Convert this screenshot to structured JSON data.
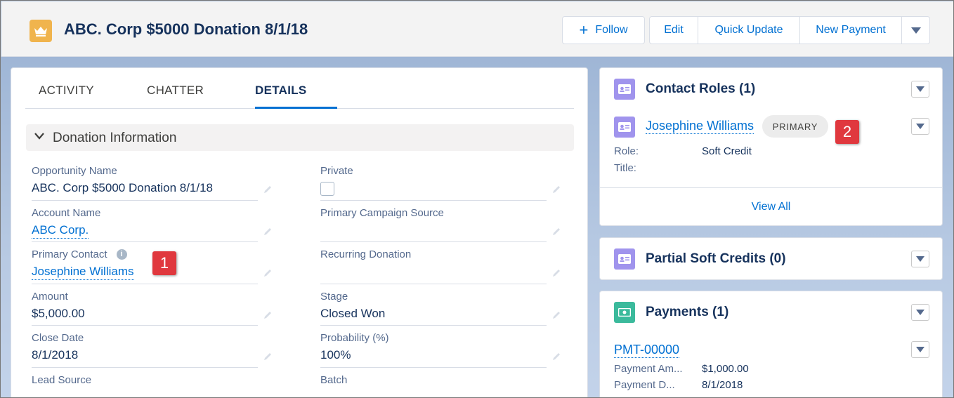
{
  "header": {
    "icon": "crown-icon",
    "title": "ABC. Corp $5000 Donation 8/1/18",
    "follow_label": "Follow",
    "actions": [
      "Edit",
      "Quick Update",
      "New Payment"
    ]
  },
  "tabs": [
    {
      "label": "ACTIVITY",
      "active": false
    },
    {
      "label": "CHATTER",
      "active": false
    },
    {
      "label": "DETAILS",
      "active": true
    }
  ],
  "section": {
    "title": "Donation Information"
  },
  "fields": {
    "opportunity_name": {
      "label": "Opportunity Name",
      "value": "ABC. Corp $5000 Donation 8/1/18"
    },
    "private": {
      "label": "Private",
      "checked": false
    },
    "account_name": {
      "label": "Account Name",
      "value": "ABC Corp."
    },
    "primary_campaign_source": {
      "label": "Primary Campaign Source",
      "value": ""
    },
    "primary_contact": {
      "label": "Primary Contact",
      "value": "Josephine Williams"
    },
    "recurring_donation": {
      "label": "Recurring Donation",
      "value": ""
    },
    "amount": {
      "label": "Amount",
      "value": "$5,000.00"
    },
    "stage": {
      "label": "Stage",
      "value": "Closed Won"
    },
    "close_date": {
      "label": "Close Date",
      "value": "8/1/2018"
    },
    "probability": {
      "label": "Probability (%)",
      "value": "100%"
    },
    "lead_source": {
      "label": "Lead Source"
    },
    "batch": {
      "label": "Batch"
    }
  },
  "callouts": {
    "one": "1",
    "two": "2"
  },
  "contact_roles": {
    "title": "Contact Roles (1)",
    "contact_name": "Josephine Williams",
    "badge": "PRIMARY",
    "role_label": "Role:",
    "role_value": "Soft Credit",
    "title_label": "Title:",
    "view_all": "View All"
  },
  "partial_soft_credits": {
    "title": "Partial Soft Credits (0)"
  },
  "payments": {
    "title": "Payments (1)",
    "payment_id": "PMT-00000",
    "amount_label": "Payment Am...",
    "amount_value": "$1,000.00",
    "date_label": "Payment D...",
    "date_value": "8/1/2018"
  },
  "colors": {
    "accent": "#0070d2",
    "crown_icon_bg": "#f0b44d",
    "contact_icon_bg": "#a094ed",
    "payment_icon_bg": "#3bba9c",
    "callout_bg": "#e0383e"
  }
}
